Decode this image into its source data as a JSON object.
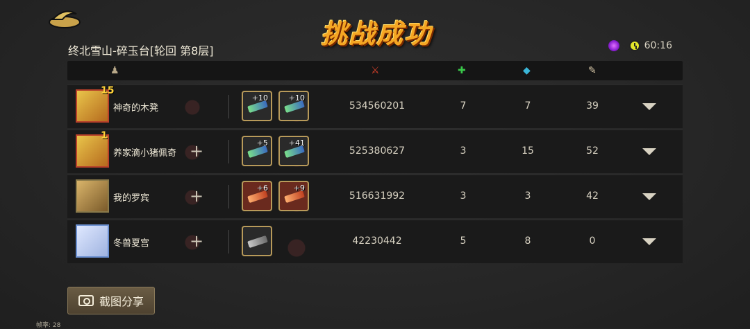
{
  "banner": "挑战成功",
  "stage_title": "终北雪山-碎玉台[轮回  第8层]",
  "timer": "60:16",
  "fps_label": "帧率: 28",
  "share_label": "截图分享",
  "colors": {
    "banner": "#f5a623",
    "row_bg": "#1a1a1a",
    "accent": "#b89a5a"
  },
  "header_icons": [
    "player-icon",
    "damage-icon",
    "heal-icon",
    "pet-icon",
    "bone-icon"
  ],
  "players": [
    {
      "name": "神奇的木凳",
      "level": "15",
      "score": "534560201",
      "heal": "7",
      "pet": "7",
      "bone": "39",
      "weapons": [
        "+10",
        "+10"
      ],
      "style": "gold"
    },
    {
      "name": "养家滴小猪佩奇",
      "level": "1",
      "score": "525380627",
      "heal": "3",
      "pet": "15",
      "bone": "52",
      "weapons": [
        "+5",
        "+41"
      ],
      "style": "gold"
    },
    {
      "name": "我的罗宾",
      "level": "",
      "score": "516631992",
      "heal": "3",
      "pet": "3",
      "bone": "42",
      "weapons": [
        "+6",
        "+9"
      ],
      "style": "plain"
    },
    {
      "name": "冬兽夏宫",
      "level": "",
      "score": "42230442",
      "heal": "5",
      "pet": "8",
      "bone": "0",
      "weapons": [
        ""
      ],
      "style": "blue"
    }
  ]
}
